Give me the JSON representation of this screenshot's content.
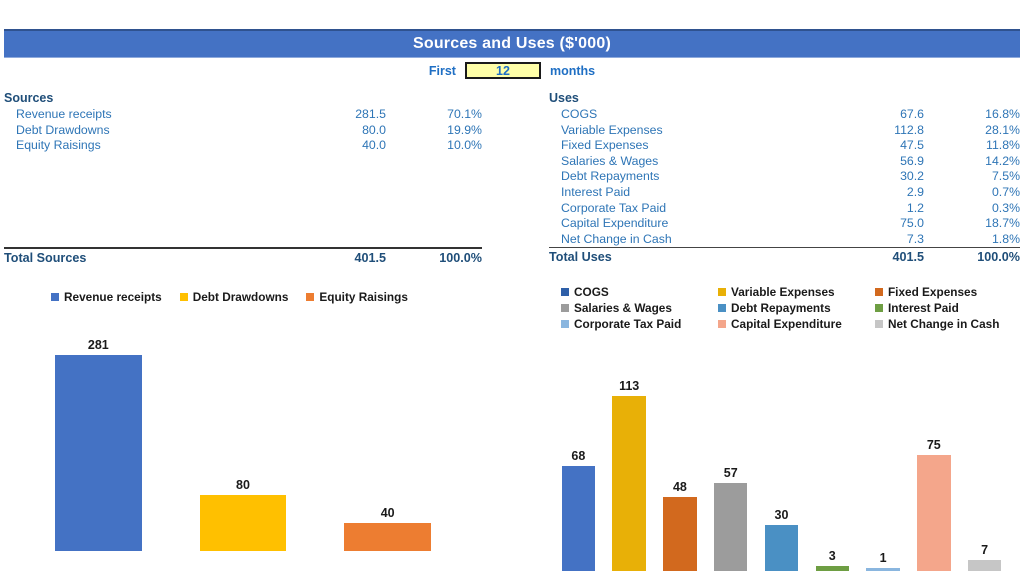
{
  "header": {
    "title": "Sources and Uses ($'000)",
    "bar_color": "#4472C4"
  },
  "period": {
    "prefix_label": "First",
    "value": "12",
    "suffix_label": "months",
    "input_bg": "#FFFFA8"
  },
  "sources_table": {
    "heading": "Sources",
    "rows": [
      {
        "label": "Revenue receipts",
        "value": "281.5",
        "pct": "70.1%"
      },
      {
        "label": "Debt Drawdowns",
        "value": "80.0",
        "pct": "19.9%"
      },
      {
        "label": "Equity Raisings",
        "value": "40.0",
        "pct": "10.0%"
      }
    ],
    "total": {
      "label": "Total Sources",
      "value": "401.5",
      "pct": "100.0%"
    }
  },
  "uses_table": {
    "heading": "Uses",
    "rows": [
      {
        "label": "COGS",
        "value": "67.6",
        "pct": "16.8%"
      },
      {
        "label": "Variable Expenses",
        "value": "112.8",
        "pct": "28.1%"
      },
      {
        "label": "Fixed Expenses",
        "value": "47.5",
        "pct": "11.8%"
      },
      {
        "label": "Salaries & Wages",
        "value": "56.9",
        "pct": "14.2%"
      },
      {
        "label": "Debt Repayments",
        "value": "30.2",
        "pct": "7.5%"
      },
      {
        "label": "Interest Paid",
        "value": "2.9",
        "pct": "0.7%"
      },
      {
        "label": "Corporate Tax Paid",
        "value": "1.2",
        "pct": "0.3%"
      },
      {
        "label": "Capital Expenditure",
        "value": "75.0",
        "pct": "18.7%"
      },
      {
        "label": "Net Change in Cash",
        "value": "7.3",
        "pct": "1.8%"
      }
    ],
    "total": {
      "label": "Total Uses",
      "value": "401.5",
      "pct": "100.0%"
    }
  },
  "chart_data": [
    {
      "id": "sources_chart",
      "type": "bar",
      "title": "",
      "xlabel": "",
      "ylabel": "",
      "legend_position": "top",
      "grid": false,
      "ylim": [
        0,
        300
      ],
      "categories": [
        "Revenue receipts",
        "Debt Drawdowns",
        "Equity Raisings"
      ],
      "values": [
        281,
        80,
        40
      ],
      "data_labels": [
        "281",
        "80",
        "40"
      ],
      "colors": [
        "#4472C4",
        "#FFC000",
        "#ED7D31"
      ],
      "legend": [
        {
          "label": "Revenue receipts",
          "color": "#4472C4"
        },
        {
          "label": "Debt Drawdowns",
          "color": "#FFC000"
        },
        {
          "label": "Equity Raisings",
          "color": "#ED7D31"
        }
      ]
    },
    {
      "id": "uses_chart",
      "type": "bar",
      "title": "",
      "xlabel": "",
      "ylabel": "",
      "legend_position": "top",
      "grid": false,
      "ylim": [
        0,
        120
      ],
      "categories": [
        "COGS",
        "Variable Expenses",
        "Fixed Expenses",
        "Salaries & Wages",
        "Debt Repayments",
        "Interest Paid",
        "Corporate Tax Paid",
        "Capital Expenditure",
        "Net Change in Cash"
      ],
      "values": [
        68,
        113,
        48,
        57,
        30,
        3,
        1,
        75,
        7
      ],
      "data_labels": [
        "68",
        "113",
        "48",
        "57",
        "30",
        "3",
        "1",
        "75",
        "7"
      ],
      "colors": [
        "#4472C4",
        "#E8B007",
        "#D2691E",
        "#9C9C9C",
        "#4A90C4",
        "#6E9E43",
        "#8AB6DF",
        "#F4A68B",
        "#C6C6C6"
      ],
      "legend": [
        {
          "label": "COGS",
          "color": "#2E5FA8"
        },
        {
          "label": "Variable Expenses",
          "color": "#E8B007"
        },
        {
          "label": "Fixed Expenses",
          "color": "#D2691E"
        },
        {
          "label": "Salaries & Wages",
          "color": "#9C9C9C"
        },
        {
          "label": "Debt Repayments",
          "color": "#4A90C4"
        },
        {
          "label": "Interest Paid",
          "color": "#6E9E43"
        },
        {
          "label": "Corporate Tax Paid",
          "color": "#8AB6DF"
        },
        {
          "label": "Capital Expenditure",
          "color": "#F4A68B"
        },
        {
          "label": "Net Change in Cash",
          "color": "#C6C6C6"
        }
      ]
    }
  ]
}
